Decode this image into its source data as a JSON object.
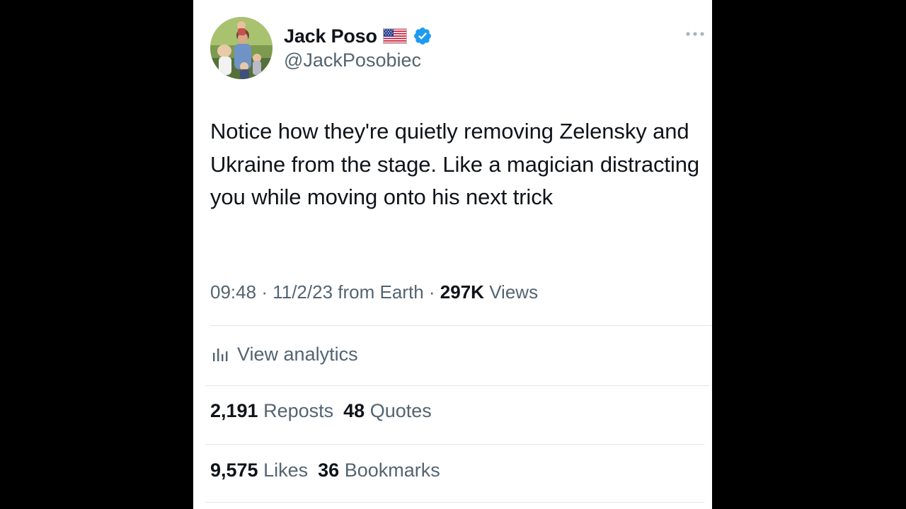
{
  "author": {
    "display_name": "Jack Poso",
    "handle": "@JackPosobiec",
    "flag_icon": "us-flag-icon",
    "verified_color": "#1d9bf0"
  },
  "tweet": {
    "text": "Notice how they're quietly removing Zelensky and Ukraine from the stage. Like a magician distracting you while moving onto his next trick"
  },
  "meta": {
    "time": "09:48",
    "date": "11/2/23",
    "source": "from Earth",
    "separator": "·",
    "views_count": "297K",
    "views_label": "Views"
  },
  "analytics": {
    "label": "View analytics",
    "icon": "analytics-bars-icon"
  },
  "stats": {
    "reposts_count": "2,191",
    "reposts_label": "Reposts",
    "quotes_count": "48",
    "quotes_label": "Quotes",
    "likes_count": "9,575",
    "likes_label": "Likes",
    "bookmarks_count": "36",
    "bookmarks_label": "Bookmarks"
  },
  "colors": {
    "text_primary": "#0f1419",
    "text_secondary": "#536471",
    "divider": "#e1e6ea",
    "background": "#ffffff",
    "letterbox": "#000000"
  }
}
